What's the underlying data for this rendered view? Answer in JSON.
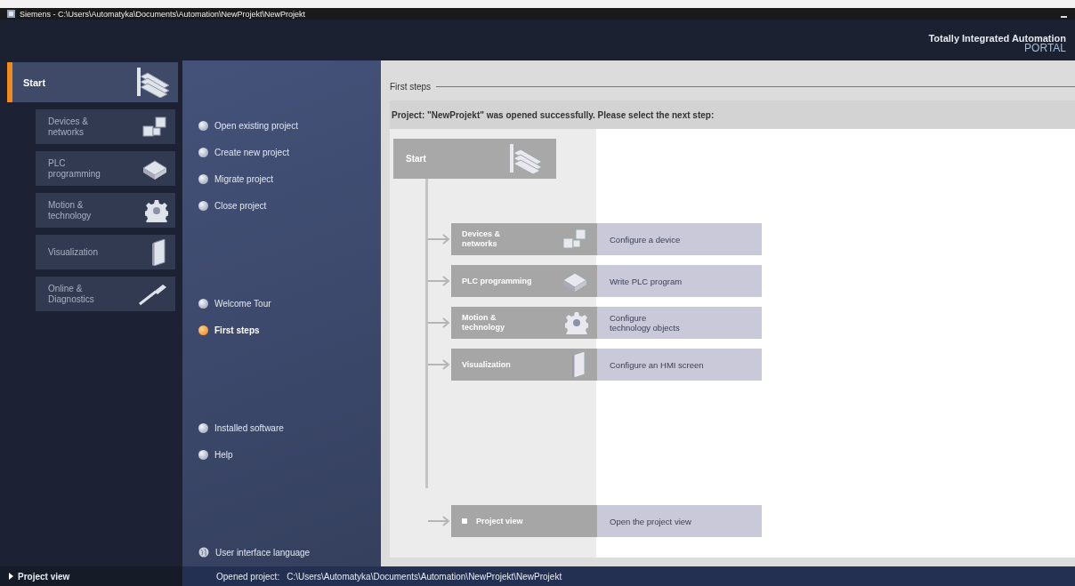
{
  "window": {
    "title": "Siemens  -  C:\\Users\\Automatyka\\Documents\\Automation\\NewProjekt\\NewProjekt"
  },
  "brand": {
    "line1": "Totally Integrated Automation",
    "line2": "PORTAL"
  },
  "nav": {
    "start": {
      "label": "Start",
      "selected": true
    },
    "portals": [
      {
        "label": "Devices &\nnetworks",
        "kind": "devices",
        "selected": false
      },
      {
        "label": "PLC\nprogramming",
        "kind": "plc",
        "selected": false
      },
      {
        "label": "Motion &\ntechnology",
        "kind": "motion",
        "selected": false
      },
      {
        "label": "Visualization",
        "kind": "visualization",
        "selected": false
      },
      {
        "label": "Online &\nDiagnostics",
        "kind": "online",
        "selected": false
      }
    ]
  },
  "actions": [
    {
      "label": "Open existing project",
      "kind": "bullet",
      "selected": false
    },
    {
      "label": "Create new project",
      "kind": "bullet",
      "selected": false
    },
    {
      "label": "Migrate project",
      "kind": "bullet",
      "selected": false
    },
    {
      "label": "Close project",
      "kind": "bullet",
      "selected": false
    },
    {
      "label": "Welcome Tour",
      "kind": "bullet",
      "selected": false
    },
    {
      "label": "First steps",
      "kind": "bullet",
      "selected": true
    },
    {
      "label": "Installed software",
      "kind": "bullet",
      "selected": false
    },
    {
      "label": "Help",
      "kind": "bullet",
      "selected": false
    },
    {
      "label": "User interface language",
      "kind": "globe",
      "selected": false
    }
  ],
  "content": {
    "title": "First steps",
    "message": "Project: \"NewProjekt\" was opened successfully. Please select the next step:",
    "start_box": "Start",
    "steps": [
      {
        "portal": "Devices &\nnetworks",
        "kind": "devices",
        "action": "Configure a device"
      },
      {
        "portal": "PLC programming",
        "kind": "plc",
        "action": "Write PLC program"
      },
      {
        "portal": "Motion &\ntechnology",
        "kind": "motion",
        "action": "Configure\ntechnology objects"
      },
      {
        "portal": "Visualization",
        "kind": "visualization",
        "action": "Configure an HMI screen"
      },
      {
        "portal": "Project view",
        "kind": "project",
        "action": "Open the project view"
      }
    ]
  },
  "status_bar": {
    "project_view": "Project view",
    "opened_label": "Opened project:",
    "path": "C:\\Users\\Automatyka\\Documents\\Automation\\NewProjekt\\NewProjekt"
  }
}
